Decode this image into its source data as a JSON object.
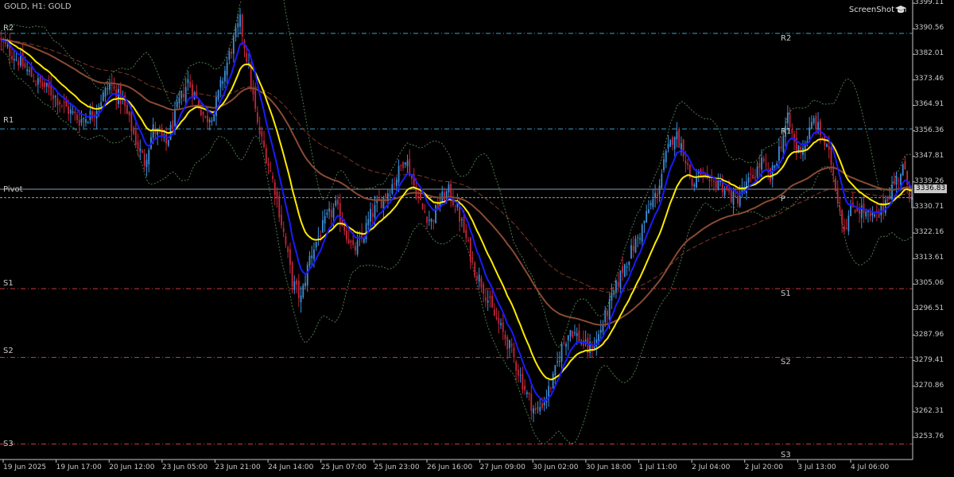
{
  "title": "GOLD, H1:  GOLD",
  "watermark": "ScreenShot",
  "icons": {
    "watermark": "graduation-cap-icon"
  },
  "price_label": "3336.83",
  "pivot_left_labels": {
    "r2": "R2",
    "r1": "R1",
    "pivot": "Pivot",
    "s1": "S1",
    "s2": "S2",
    "s3": "S3"
  },
  "pivot_right_labels": {
    "r2": "R2",
    "r1": "R1",
    "p": "P",
    "s1": "S1",
    "s2": "S2",
    "s3": "S3"
  },
  "colors": {
    "bull": "#3d8ed8",
    "bear": "#c8253a",
    "ema_fast": "#1a1aff",
    "ema_slow": "#ffeb00",
    "ma_long": "#8a4a32",
    "ma_longer": "#7a3a28",
    "bands": "#4f7a4f",
    "resistance": "#3aa0c8",
    "support": "#c83a3a",
    "pivot": "#8aa0b4"
  },
  "chart_data": {
    "type": "candlestick",
    "symbol": "GOLD",
    "timeframe": "H1",
    "ylim": [
      3249.5,
      3399.11
    ],
    "y_ticks": [
      "3399.11",
      "3390.56",
      "3382.01",
      "3373.46",
      "3364.91",
      "3356.36",
      "3347.81",
      "3339.26",
      "3330.71",
      "3322.16",
      "3313.61",
      "3305.06",
      "3296.51",
      "3287.96",
      "3279.41",
      "3270.86",
      "3262.31",
      "3253.76"
    ],
    "x_ticks": [
      "19 Jun 2025",
      "19 Jun 17:00",
      "20 Jun 12:00",
      "23 Jun 05:00",
      "23 Jun 21:00",
      "24 Jun 14:00",
      "25 Jun 07:00",
      "25 Jun 23:00",
      "26 Jun 16:00",
      "27 Jun 09:00",
      "30 Jun 02:00",
      "30 Jun 18:00",
      "1 Jul 11:00",
      "2 Jul 04:00",
      "2 Jul 20:00",
      "3 Jul 13:00",
      "4 Jul 06:00"
    ],
    "last_price": 3336.83,
    "pivot_levels": [
      {
        "name": "R2",
        "value": 3389.0,
        "start_bar": 0
      },
      {
        "name": "R1",
        "value": 3357.0,
        "start_bar": 0
      },
      {
        "name": "Pivot",
        "value": 3334.0,
        "start_bar": 0
      },
      {
        "name": "S1",
        "value": 3303.5,
        "start_bar": 0
      },
      {
        "name": "S2",
        "value": 3280.5,
        "start_bar": 0
      },
      {
        "name": "S3",
        "value": 3251.5,
        "start_bar": 0
      }
    ],
    "close_path": [
      [
        0,
        3386
      ],
      [
        8,
        3380
      ],
      [
        16,
        3373
      ],
      [
        22,
        3370
      ],
      [
        30,
        3364
      ],
      [
        36,
        3360
      ],
      [
        42,
        3362
      ],
      [
        50,
        3372
      ],
      [
        56,
        3366
      ],
      [
        62,
        3353
      ],
      [
        66,
        3346
      ],
      [
        70,
        3357
      ],
      [
        76,
        3352
      ],
      [
        82,
        3366
      ],
      [
        86,
        3373
      ],
      [
        90,
        3367
      ],
      [
        94,
        3360
      ],
      [
        98,
        3363
      ],
      [
        102,
        3374
      ],
      [
        106,
        3384
      ],
      [
        110,
        3393
      ],
      [
        114,
        3377
      ],
      [
        118,
        3358
      ],
      [
        122,
        3348
      ],
      [
        126,
        3337
      ],
      [
        130,
        3322
      ],
      [
        134,
        3306
      ],
      [
        138,
        3300
      ],
      [
        142,
        3314
      ],
      [
        146,
        3321
      ],
      [
        150,
        3327
      ],
      [
        154,
        3331
      ],
      [
        158,
        3324
      ],
      [
        162,
        3316
      ],
      [
        166,
        3320
      ],
      [
        170,
        3328
      ],
      [
        174,
        3332
      ],
      [
        178,
        3336
      ],
      [
        182,
        3341
      ],
      [
        186,
        3348
      ],
      [
        190,
        3338
      ],
      [
        194,
        3330
      ],
      [
        198,
        3326
      ],
      [
        202,
        3333
      ],
      [
        206,
        3336
      ],
      [
        210,
        3330
      ],
      [
        214,
        3320
      ],
      [
        218,
        3310
      ],
      [
        222,
        3304
      ],
      [
        226,
        3296
      ],
      [
        230,
        3290
      ],
      [
        234,
        3284
      ],
      [
        238,
        3276
      ],
      [
        242,
        3268
      ],
      [
        246,
        3262
      ],
      [
        250,
        3266
      ],
      [
        254,
        3273
      ],
      [
        258,
        3284
      ],
      [
        262,
        3290
      ],
      [
        266,
        3287
      ],
      [
        270,
        3283
      ],
      [
        274,
        3286
      ],
      [
        278,
        3294
      ],
      [
        282,
        3302
      ],
      [
        286,
        3310
      ],
      [
        290,
        3316
      ],
      [
        294,
        3322
      ],
      [
        298,
        3330
      ],
      [
        302,
        3336
      ],
      [
        306,
        3348
      ],
      [
        310,
        3356
      ],
      [
        314,
        3350
      ],
      [
        318,
        3338
      ],
      [
        322,
        3342
      ],
      [
        326,
        3337
      ],
      [
        330,
        3340
      ],
      [
        334,
        3336
      ],
      [
        338,
        3333
      ],
      [
        342,
        3337
      ],
      [
        346,
        3341
      ],
      [
        350,
        3346
      ],
      [
        354,
        3340
      ],
      [
        358,
        3350
      ],
      [
        362,
        3360
      ],
      [
        366,
        3350
      ],
      [
        370,
        3352
      ],
      [
        374,
        3360
      ],
      [
        378,
        3354
      ],
      [
        382,
        3346
      ],
      [
        386,
        3330
      ],
      [
        388,
        3324
      ],
      [
        392,
        3331
      ],
      [
        396,
        3330
      ],
      [
        400,
        3327
      ],
      [
        404,
        3328
      ],
      [
        408,
        3335
      ],
      [
        412,
        3340
      ],
      [
        415,
        3344
      ],
      [
        418,
        3336
      ]
    ],
    "indicators": {
      "ema_fast": "blue moving average",
      "ema_slow": "yellow moving average",
      "ma_long": "brown moving average",
      "ma_longer": "dashed brown moving average",
      "bands": "dotted green envelope bands"
    }
  }
}
